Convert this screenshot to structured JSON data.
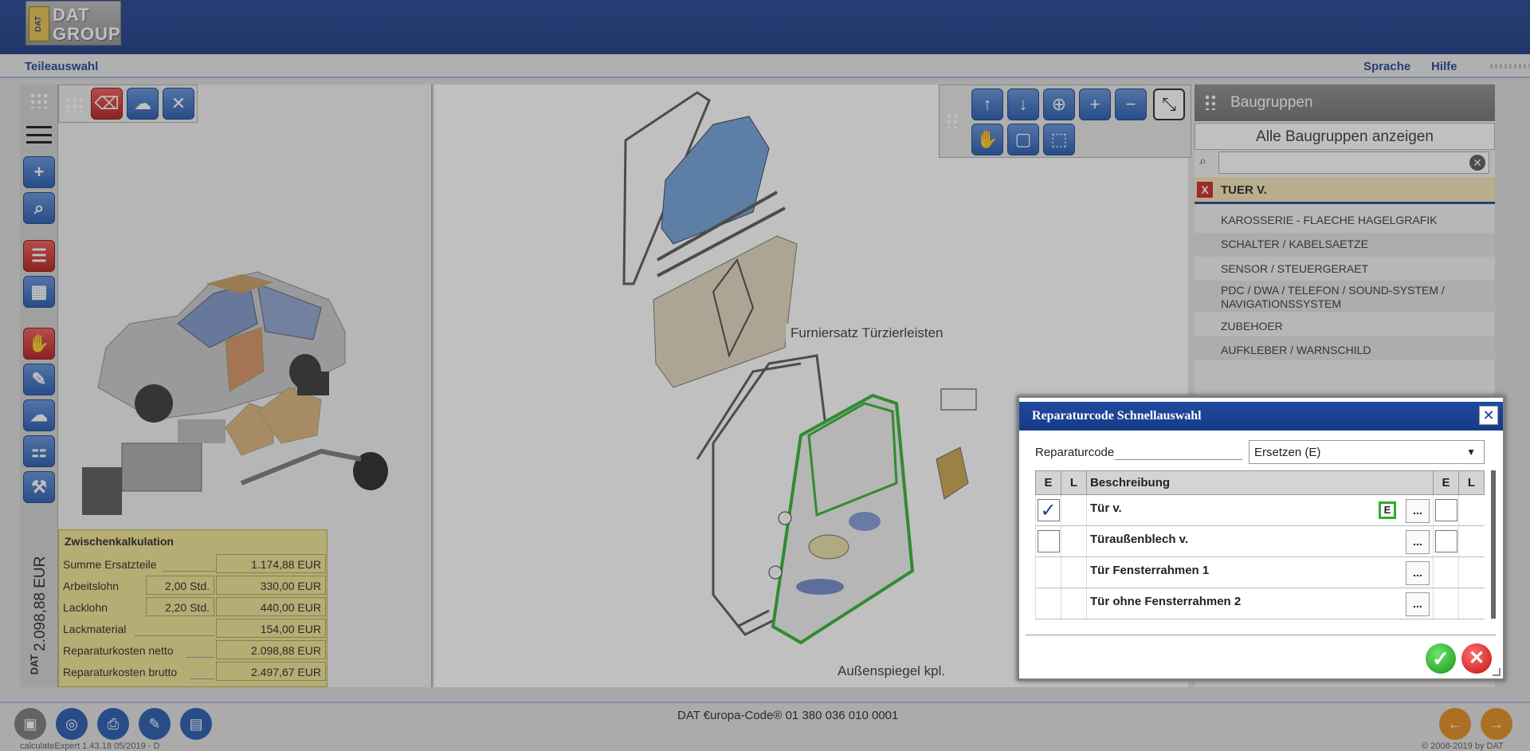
{
  "header": {
    "logo_line1": "DAT",
    "logo_line2": "GROUP",
    "logo_mark": "DAT"
  },
  "subbar": {
    "left_link": "Teileauswahl",
    "language": "Sprache",
    "help": "Hilfe"
  },
  "kalkulation": {
    "title": "Zwischenkalkulation",
    "vertical_total": "2.098,88 EUR",
    "rows": [
      {
        "label": "Summe Ersatzteile",
        "hours": "",
        "value": "1.174,88 EUR"
      },
      {
        "label": "Arbeitslohn",
        "hours": "2,00 Std.",
        "value": "330,00 EUR"
      },
      {
        "label": "Lacklohn",
        "hours": "2,20 Std.",
        "value": "440,00 EUR"
      },
      {
        "label": "Lackmaterial",
        "hours": "",
        "value": "154,00 EUR"
      },
      {
        "label": "Reparaturkosten netto",
        "hours": "",
        "value": "2.098,88 EUR"
      },
      {
        "label": "Reparaturkosten brutto",
        "hours": "",
        "value": "2.497,67 EUR"
      }
    ]
  },
  "diagram": {
    "label1": "Furniersatz Türzierleisten",
    "label2": "Außenspiegel kpl."
  },
  "baugruppen": {
    "title": "Baugruppen",
    "show_all": "Alle Baugruppen anzeigen",
    "search_placeholder": "",
    "selected": "TUER V.",
    "items": [
      "KAROSSERIE - FLAECHE HAGELGRAFIK",
      "SCHALTER / KABELSAETZE",
      "SENSOR / STEUERGERAET",
      "PDC / DWA / TELEFON / SOUND-SYSTEM / NAVIGATIONSSYSTEM",
      "ZUBEHOER",
      "AUFKLEBER / WARNSCHILD"
    ]
  },
  "dialog": {
    "title": "Reparaturcode Schnellauswahl",
    "code_label": "Reparaturcode",
    "code_value": "Ersetzen (E)",
    "columns": {
      "e": "E",
      "l": "L",
      "desc": "Beschreibung",
      "e2": "E",
      "l2": "L"
    },
    "rows": [
      {
        "desc": "Tür v.",
        "checked": true,
        "badge": "E"
      },
      {
        "desc": "Türaußenblech v.",
        "checked": false,
        "badge": ""
      },
      {
        "desc": "Tür Fensterrahmen 1",
        "checked": false,
        "badge": ""
      },
      {
        "desc": "Tür ohne Fensterrahmen 2",
        "checked": false,
        "badge": ""
      }
    ],
    "dots": "..."
  },
  "footer": {
    "eurocode": "DAT €uropa-Code® 01 380 036 010 0001",
    "version": "calculateExpert 1.43.18 05/2019 - D",
    "copyright": "© 2008-2019 by DAT"
  },
  "colors": {
    "brand_blue": "#1d3f91",
    "highlight_green": "#2db12d",
    "kalk_yellow": "#efe38f"
  }
}
